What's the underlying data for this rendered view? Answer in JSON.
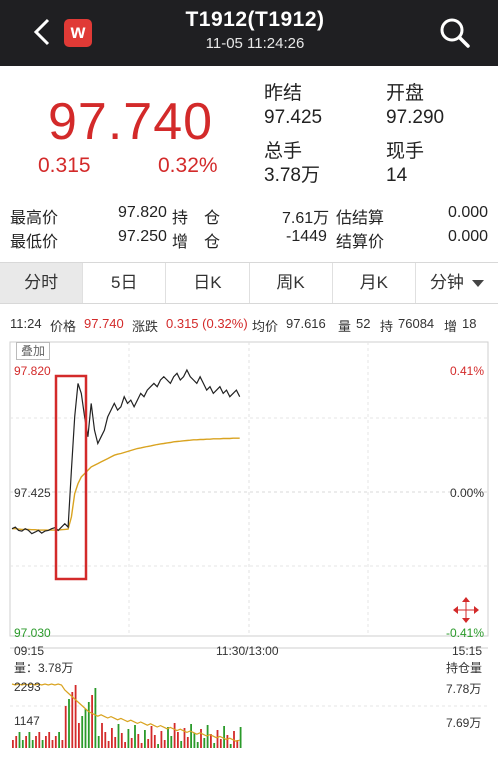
{
  "header": {
    "title": "T1912(T1912)",
    "datetime": "11-05 11:24:26",
    "logo_letter": "w"
  },
  "quote": {
    "price": "97.740",
    "change": "0.315",
    "change_pct": "0.32%",
    "prev_settle_label": "昨结",
    "prev_settle": "97.425",
    "open_label": "开盘",
    "open": "97.290",
    "total_volume_label": "总手",
    "total_volume": "3.78万",
    "current_volume_label": "现手",
    "current_volume": "14"
  },
  "stats": {
    "high_label": "最高价",
    "high": "97.820",
    "open_interest_label": "持　仓",
    "open_interest": "7.61万",
    "est_settle_label": "估结算",
    "est_settle": "0.000",
    "low_label": "最低价",
    "low": "97.250",
    "oi_change_label": "增　仓",
    "oi_change": "-1449",
    "settle_label": "结算价",
    "settle": "0.000"
  },
  "tabs": [
    "分时",
    "5日",
    "日K",
    "周K",
    "月K",
    "分钟"
  ],
  "info": {
    "time": "11:24",
    "price_label": "价格",
    "price": "97.740",
    "change_label": "涨跌",
    "change": "0.315 (0.32%)",
    "avg_label": "均价",
    "avg": "97.616",
    "vol_label": "量",
    "vol": "52",
    "oi_label": "持",
    "oi": "76084",
    "inc_label": "增",
    "inc": "18"
  },
  "chart": {
    "overlay_label": "叠加",
    "y_high": "97.820",
    "y_mid": "97.425",
    "y_low": "97.030",
    "pct_high": "0.41%",
    "pct_mid": "0.00%",
    "pct_low": "-0.41%",
    "x_start": "09:15",
    "x_mid": "11:30/13:00",
    "x_end": "15:15",
    "volume_label": "量：3.78万",
    "oi_label": "持仓量",
    "vol_high": "2293",
    "vol_mid": "1147",
    "oi_high": "7.78万",
    "oi_low": "7.69万"
  },
  "colors": {
    "up": "#d32a2a",
    "down": "#2a9a2a",
    "avg_line": "#d9a320",
    "highlight_box": "#d32a2a"
  },
  "chart_data": {
    "type": "line",
    "ylim": [
      97.03,
      97.82
    ],
    "series": [
      {
        "values": [
          97.345,
          97.35,
          97.34,
          97.338,
          97.345,
          97.34,
          97.33,
          97.335,
          97.34,
          97.332,
          97.338,
          97.34,
          97.345,
          97.348,
          97.34,
          97.35,
          97.36,
          97.35,
          97.52,
          97.68,
          97.78,
          97.75,
          97.68,
          97.62,
          97.72,
          97.64,
          97.6,
          97.62,
          97.64,
          97.68,
          97.7,
          97.72,
          97.7,
          97.71,
          97.74,
          97.72,
          97.73,
          97.71,
          97.73,
          97.75,
          97.74,
          97.76,
          97.77,
          97.78,
          97.77,
          97.79,
          97.8,
          97.79,
          97.78,
          97.8,
          97.81,
          97.79,
          97.8,
          97.82,
          97.8,
          97.79,
          97.78,
          97.8,
          97.78,
          97.76,
          97.77,
          97.75,
          97.76,
          97.77,
          97.75,
          97.76,
          97.74,
          97.75,
          97.76,
          97.74
        ]
      },
      {
        "values": [
          97.345,
          97.345,
          97.344,
          97.343,
          97.343,
          97.343,
          97.342,
          97.342,
          97.341,
          97.341,
          97.341,
          97.341,
          97.341,
          97.341,
          97.341,
          97.342,
          97.343,
          97.344,
          97.38,
          97.45,
          97.48,
          97.5,
          97.51,
          97.52,
          97.53,
          97.535,
          97.54,
          97.545,
          97.55,
          97.555,
          97.56,
          97.565,
          97.568,
          97.57,
          97.573,
          97.576,
          97.579,
          97.582,
          97.585,
          97.587,
          97.589,
          97.591,
          97.593,
          97.595,
          97.597,
          97.599,
          97.6,
          97.602,
          97.603,
          97.605,
          97.606,
          97.607,
          97.608,
          97.609,
          97.61,
          97.611,
          97.611,
          97.612,
          97.612,
          97.613,
          97.613,
          97.614,
          97.614,
          97.614,
          97.615,
          97.615,
          97.615,
          97.616,
          97.616,
          97.616
        ]
      }
    ]
  }
}
